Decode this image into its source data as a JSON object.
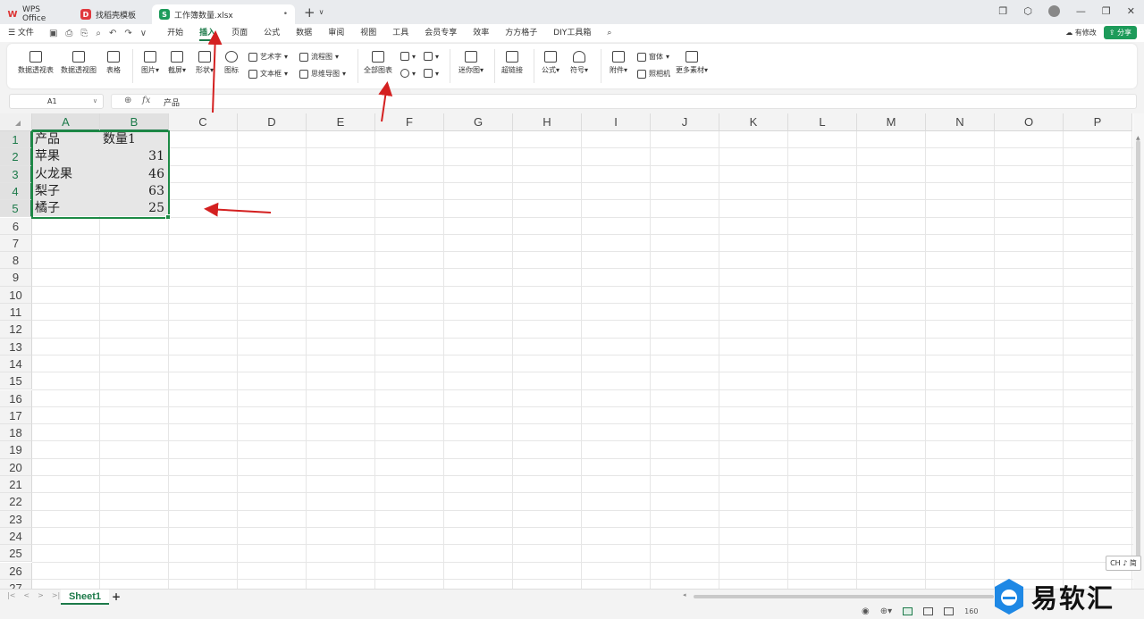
{
  "tabs": [
    {
      "label": "WPS Office",
      "logo": "W"
    },
    {
      "label": "找稻壳模板",
      "logo": "D"
    },
    {
      "label": "工作簿数量.xlsx",
      "logo": "S",
      "close": "•"
    }
  ],
  "tab_add": "+",
  "tab_more": "∨",
  "menu": {
    "file": "☰ 文件",
    "items": [
      "开始",
      "插入",
      "页面",
      "公式",
      "数据",
      "审阅",
      "视图",
      "工具",
      "会员专享",
      "效率",
      "方方格子",
      "DIY工具箱"
    ],
    "active_index": 1,
    "modify_label": "有修改",
    "share_label": "分享"
  },
  "ribbon": {
    "pivot_table": "数据透视表",
    "pivot_chart": "数据透视图",
    "table": "表格",
    "picture": "图片",
    "screenshot": "截屏",
    "shape": "形状",
    "icon": "图标",
    "art_text": "艺术字",
    "text_box": "文本框",
    "flowchart": "流程图",
    "mindmap": "思维导图",
    "all_charts": "全部图表",
    "sparkline": "迷你图",
    "hyperlink": "超链接",
    "formula": "公式",
    "symbol": "符号",
    "attachment": "附件",
    "form": "窗体",
    "camera": "照相机",
    "more_material": "更多素材"
  },
  "formula_bar": {
    "cell_ref": "A1",
    "fx": "fx",
    "value": "产品"
  },
  "columns": [
    "A",
    "B",
    "C",
    "D",
    "E",
    "F",
    "G",
    "H",
    "I",
    "J",
    "K",
    "L",
    "M",
    "N",
    "O",
    "P"
  ],
  "rows": [
    "1",
    "2",
    "3",
    "4",
    "5",
    "6",
    "7",
    "8",
    "9",
    "10",
    "11",
    "12",
    "13",
    "14",
    "15",
    "16",
    "17",
    "18",
    "19",
    "20",
    "21",
    "22",
    "23",
    "24",
    "25",
    "26",
    "27"
  ],
  "table": {
    "headers": [
      "产品",
      "数量1"
    ],
    "rows": [
      [
        "苹果",
        "31"
      ],
      [
        "火龙果",
        "46"
      ],
      [
        "梨子",
        "63"
      ],
      [
        "橘子",
        "25"
      ]
    ]
  },
  "sheets": [
    "Sheet1"
  ],
  "sheet_add": "+",
  "status": {
    "zoom": "160"
  },
  "ime": "CH ♪ 简",
  "watermark": "易软汇",
  "colors": {
    "accent": "#1d7a4a",
    "selection": "#1d8a45",
    "arrow": "#d42020"
  }
}
